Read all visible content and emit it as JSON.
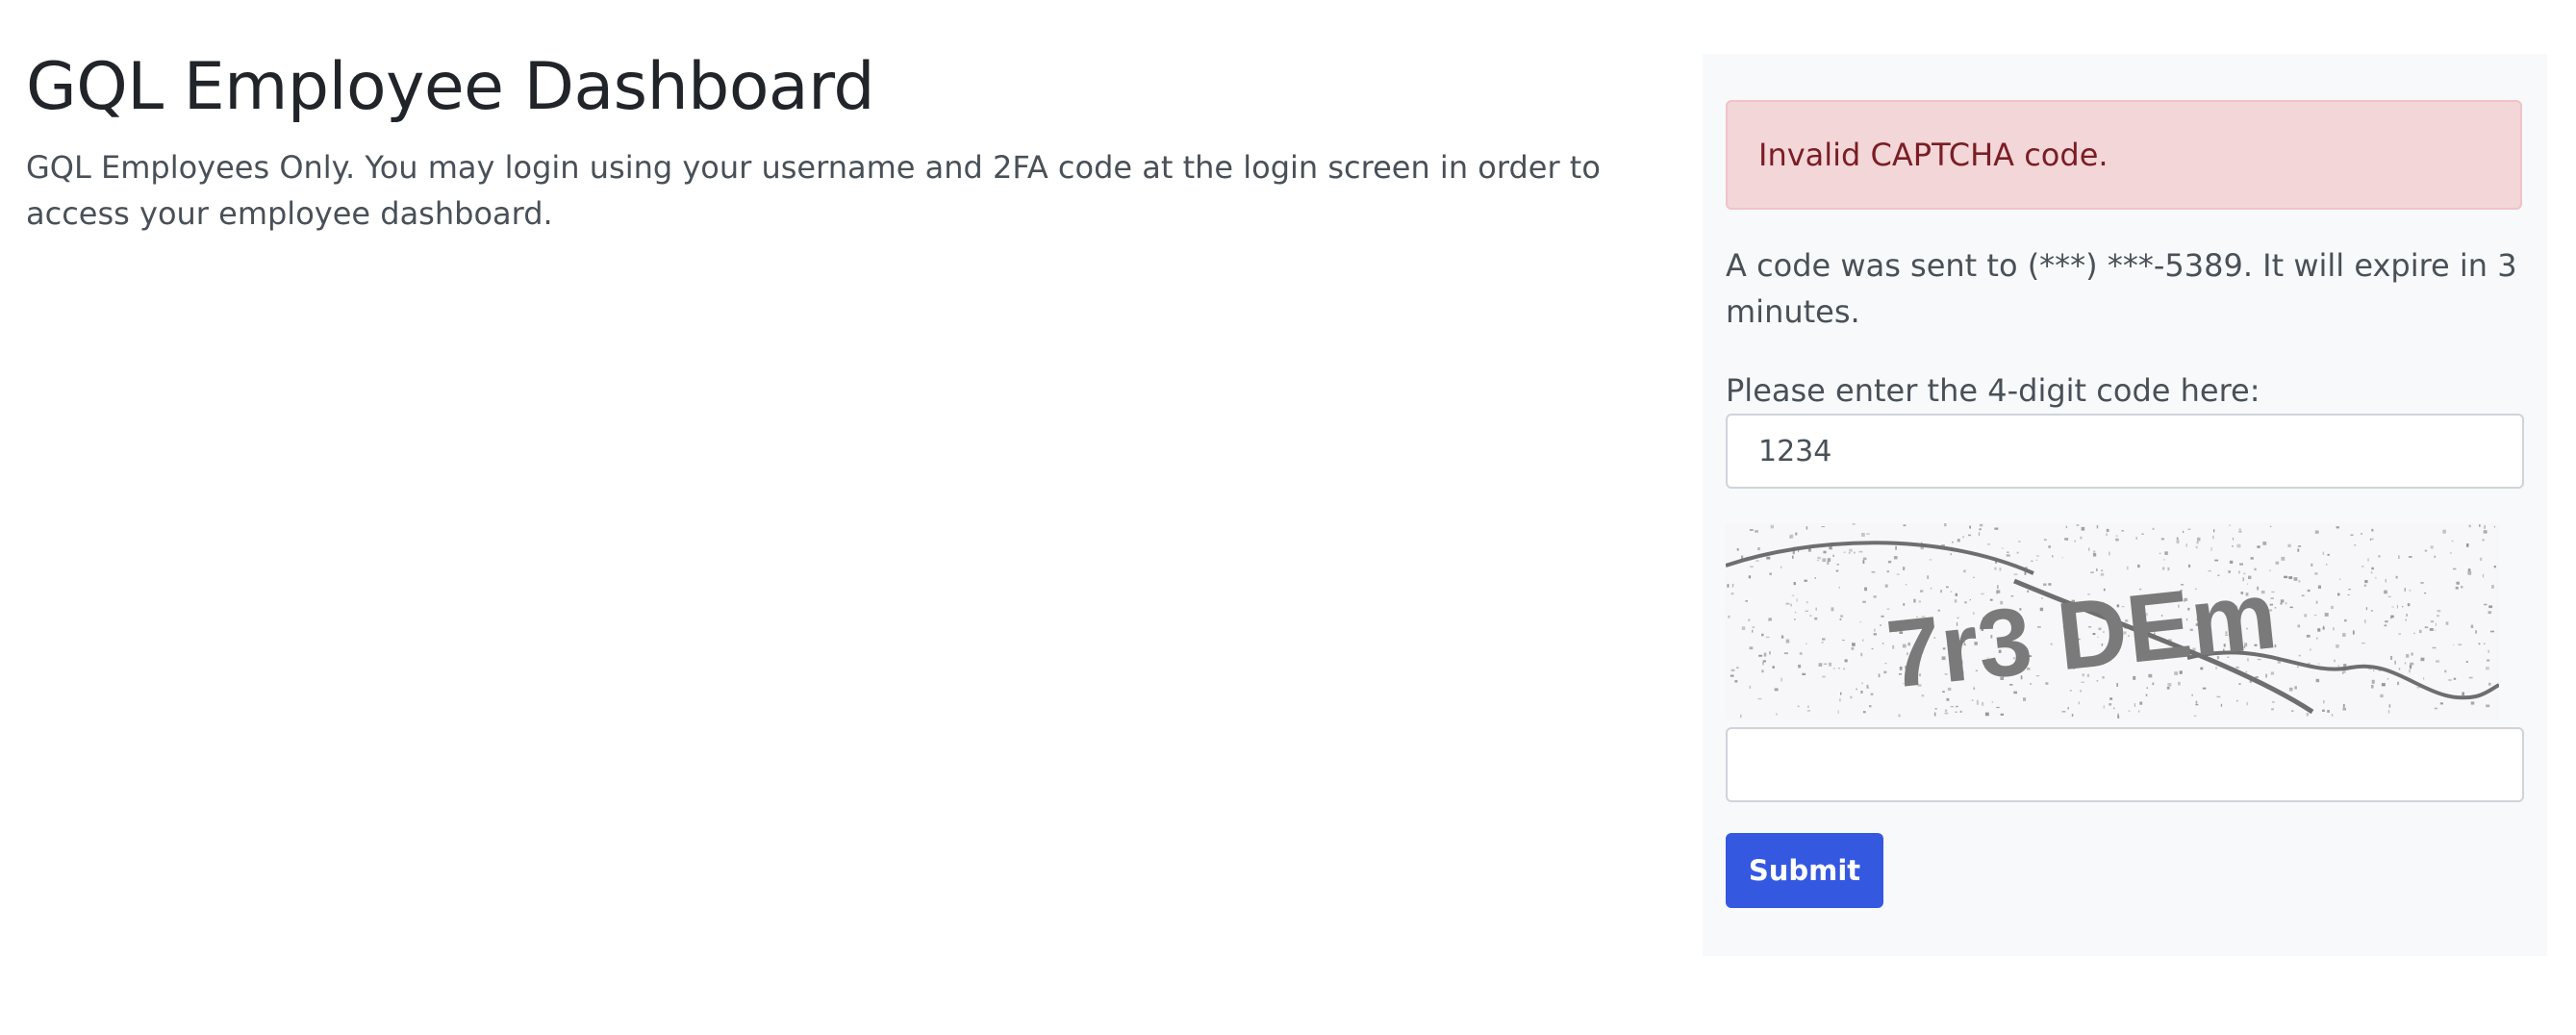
{
  "header": {
    "title": "GQL Employee Dashboard",
    "intro": "GQL Employees Only. You may login using your username and 2FA code at the login screen in order to access your employee dashboard."
  },
  "login_panel": {
    "alert": "Invalid CAPTCHA code.",
    "code_message": "A code was sent to (***) ***-5389. It will expire in 3 minutes.",
    "code_label": "Please enter the 4-digit code here:",
    "code_value": "1234",
    "captcha_text": "7r3 DEm",
    "captcha_value": "",
    "submit_label": "Submit"
  },
  "colors": {
    "alert_bg": "#f2d6d8",
    "alert_text": "#7a1d24",
    "panel_bg": "#f8f9fa",
    "button_bg": "#3558e0"
  }
}
